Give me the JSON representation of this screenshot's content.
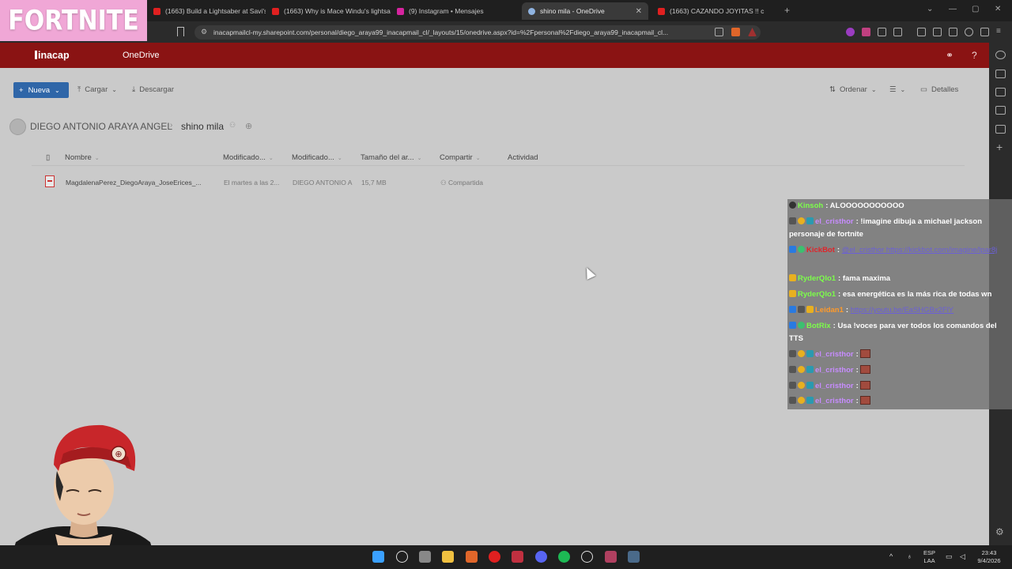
{
  "browser": {
    "tabs": [
      {
        "label": "(1663) Build a Lightsaber at Savi's W",
        "icon": "youtube-icon",
        "color": "#e02020"
      },
      {
        "label": "(1663) Why is Mace Windu's lightsab",
        "icon": "youtube-icon",
        "color": "#e02020"
      },
      {
        "label": "(9) Instagram • Mensajes",
        "icon": "instagram-icon",
        "color": "#d6249f"
      },
      {
        "label": "shino mila - OneDrive",
        "icon": "onedrive-icon",
        "color": "#8fb3e0",
        "active": true
      },
      {
        "label": "(1663) CAZANDO JOYITAS !! c",
        "icon": "youtube-icon",
        "color": "#e02020"
      }
    ],
    "url": "inacapmailcl-my.sharepoint.com/personal/diego_araya99_inacapmail_cl/_layouts/15/onedrive.aspx?id=%2Fpersonal%2Fdiego_araya99_inacapmail_cl..."
  },
  "overlay": {
    "game_logo": "FORTNITE"
  },
  "header": {
    "brand": "inacap",
    "app": "OneDrive"
  },
  "commands": {
    "new": "Nueva",
    "upload": "Cargar",
    "download": "Descargar",
    "sort": "Ordenar",
    "details": "Detalles"
  },
  "breadcrumb": {
    "owner": "DIEGO ANTONIO ARAYA ANGEL",
    "folder": "shino mila"
  },
  "columns": [
    "Nombre",
    "Modificado...",
    "Modificado...",
    "Tamaño del ar...",
    "Compartir",
    "Actividad"
  ],
  "files": [
    {
      "name": "MagdalenaPerez_DiegoAraya_JoseErices_...",
      "modified": "El martes a las 2...",
      "modified_by": "DIEGO ANTONIO A",
      "size": "15,7 MB",
      "sharing": "Compartida"
    }
  ],
  "chat": [
    {
      "user": "Kinsoh",
      "user_color": "#7cff4a",
      "text": "ALOOOOOOOOOOO"
    },
    {
      "user": "el_cristhor",
      "user_color": "#c78cff",
      "text": "!imagine dibuja a michael jackson personaje de fortnite"
    },
    {
      "user": "KickBot",
      "user_color": "#e0242a",
      "text": "@el_cristhor https://kickbot.com/imagine/lpar8j",
      "is_link": true
    },
    {
      "user": "RyderQlo1",
      "user_color": "#7cff4a",
      "text": "fama maxima"
    },
    {
      "user": "RyderQlo1",
      "user_color": "#7cff4a",
      "text": "esa energética es la más rica de todas wn"
    },
    {
      "user": "Leidan1",
      "user_color": "#ff9a2a",
      "text": "https://youtu.be/EaSHGBx2FlY",
      "is_link": true
    },
    {
      "user": "BotRix",
      "user_color": "#7cff4a",
      "text": "Usa !voces para ver todos los comandos del TTS"
    },
    {
      "user": "el_cristhor",
      "user_color": "#c78cff",
      "text": ""
    },
    {
      "user": "el_cristhor",
      "user_color": "#c78cff",
      "text": ""
    },
    {
      "user": "el_cristhor",
      "user_color": "#c78cff",
      "text": ""
    },
    {
      "user": "el_cristhor",
      "user_color": "#c78cff",
      "text": ""
    }
  ],
  "taskbar": {
    "lang_top": "ESP",
    "lang_bottom": "LAA",
    "time": "23:43",
    "date": "9/4/2026"
  },
  "colors": {
    "brand_red": "#8a1313",
    "primary_blue": "#2f66a8"
  }
}
